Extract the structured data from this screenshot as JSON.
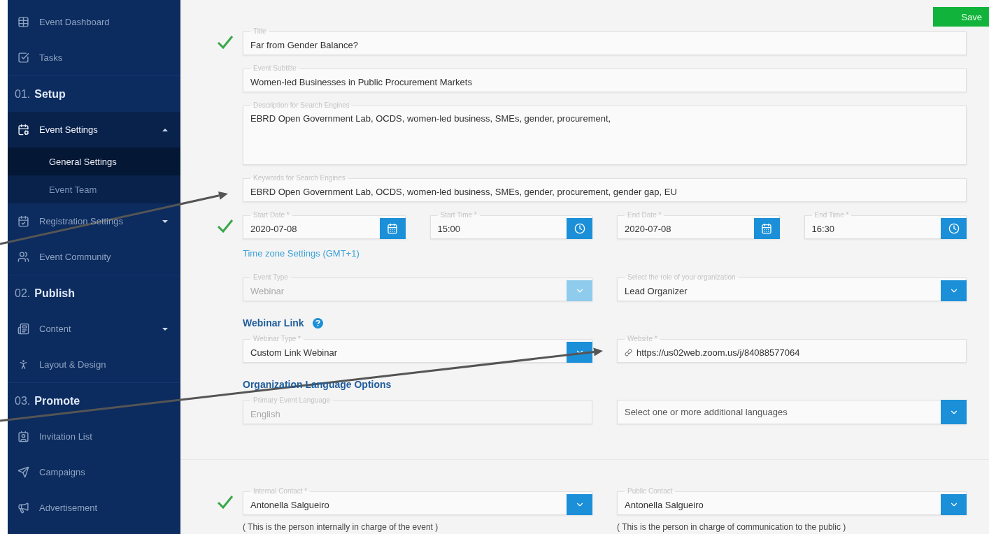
{
  "sidebar": {
    "items": [
      {
        "kind": "item",
        "label": "Event Dashboard"
      },
      {
        "kind": "item",
        "label": "Tasks"
      },
      {
        "kind": "section",
        "number": "01.",
        "label": "Setup"
      },
      {
        "kind": "group",
        "label": "Event Settings",
        "expanded": true,
        "children": [
          {
            "label": "General Settings",
            "selected": true
          },
          {
            "label": "Event Team",
            "selected": false
          }
        ]
      },
      {
        "kind": "group",
        "label": "Registration Settings",
        "expanded": false
      },
      {
        "kind": "item",
        "label": "Event Community"
      },
      {
        "kind": "section",
        "number": "02.",
        "label": "Publish"
      },
      {
        "kind": "group",
        "label": "Content",
        "expanded": false
      },
      {
        "kind": "item",
        "label": "Layout & Design"
      },
      {
        "kind": "section",
        "number": "03.",
        "label": "Promote"
      },
      {
        "kind": "item",
        "label": "Invitation List"
      },
      {
        "kind": "item",
        "label": "Campaigns"
      },
      {
        "kind": "item",
        "label": "Advertisement"
      }
    ]
  },
  "save_button": "Save",
  "rows": [
    {
      "kind": "fields",
      "valid": true,
      "fields": [
        {
          "kind": "text",
          "label": "Title",
          "value": "Far from Gender Balance?",
          "disabled": false
        }
      ]
    },
    {
      "kind": "fields",
      "valid": false,
      "fields": [
        {
          "kind": "text",
          "label": "Event Subtitle",
          "value": "Women-led Businesses in Public Procurement Markets",
          "disabled": false
        }
      ]
    },
    {
      "kind": "fields",
      "valid": false,
      "fields": [
        {
          "kind": "textarea",
          "label": "Description for Search Engines",
          "value": "EBRD Open Government Lab, OCDS, women-led business, SMEs, gender, procurement,",
          "disabled": false
        }
      ]
    },
    {
      "kind": "fields",
      "valid": false,
      "fields": [
        {
          "kind": "text",
          "label": "Keywords for Search Engines",
          "value": "EBRD Open Government Lab, OCDS, women-led business, SMEs, gender, procurement, gender gap, EU",
          "disabled": false
        }
      ]
    },
    {
      "kind": "fields",
      "valid": true,
      "fields": [
        {
          "kind": "date",
          "label": "Start Date *",
          "value": "2020-07-08",
          "disabled": false
        },
        {
          "kind": "time",
          "label": "Start Time *",
          "value": "15:00",
          "disabled": false
        },
        {
          "kind": "date",
          "label": "End Date *",
          "value": "2020-07-08",
          "disabled": false
        },
        {
          "kind": "time",
          "label": "End Time *",
          "value": "16:30",
          "disabled": false
        }
      ]
    },
    {
      "kind": "link",
      "text": "Time zone Settings (GMT+1)"
    },
    {
      "kind": "fields",
      "valid": false,
      "fields": [
        {
          "kind": "select",
          "label": "Event Type",
          "value": "Webinar",
          "disabled": true
        },
        {
          "kind": "select",
          "label": "Select the role of your organization",
          "value": "Lead Organizer",
          "disabled": false
        }
      ]
    },
    {
      "kind": "heading",
      "text": "Webinar Link",
      "help": true
    },
    {
      "kind": "fields",
      "valid": false,
      "fields": [
        {
          "kind": "select",
          "label": "Webinar Type *",
          "value": "Custom Link Webinar",
          "disabled": false
        },
        {
          "kind": "url",
          "label": "Website *",
          "value": "https://us02web.zoom.us/j/84088577064",
          "disabled": false
        }
      ]
    },
    {
      "kind": "heading",
      "text": "Organization Language Options",
      "help": false
    },
    {
      "kind": "fields",
      "valid": false,
      "fields": [
        {
          "kind": "text",
          "label": "Primary Event Language",
          "value": "English",
          "disabled": true
        },
        {
          "kind": "select",
          "placeholder": "Select one or more additional languages",
          "disabled": false
        }
      ]
    },
    {
      "kind": "divider"
    },
    {
      "kind": "fields",
      "valid": true,
      "fields": [
        {
          "kind": "select",
          "label": "Internal Contact *",
          "value": "Antonella Salgueiro",
          "disabled": false
        },
        {
          "kind": "select",
          "label": "Public Contact",
          "value": "Antonella Salgueiro",
          "disabled": false
        }
      ]
    },
    {
      "kind": "notes",
      "notes": [
        "( This is the person internally in charge of the event )",
        "( This is the person in charge of communication to the public )"
      ]
    }
  ]
}
